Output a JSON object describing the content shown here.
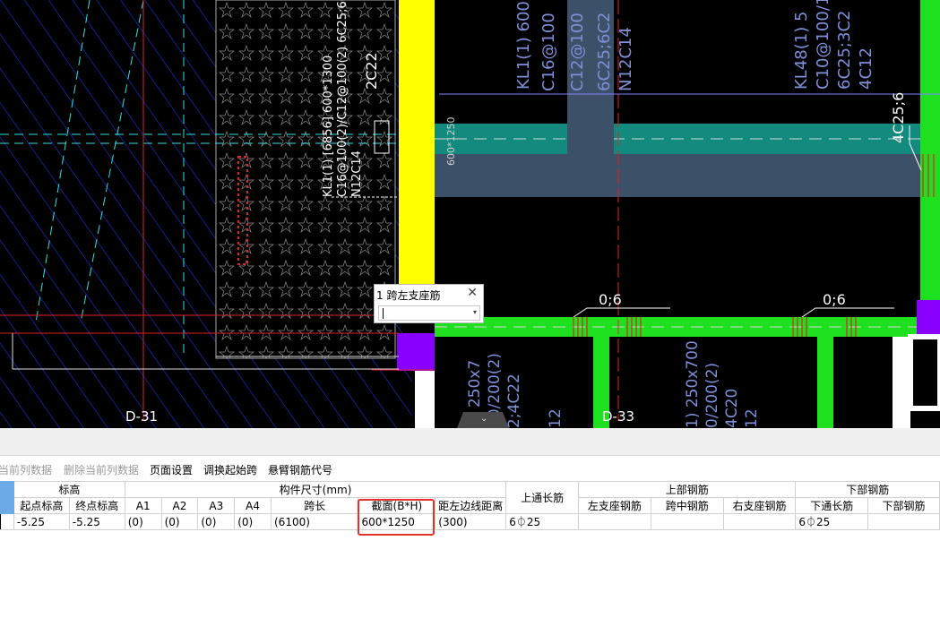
{
  "drawing": {
    "grid_labels": {
      "left": "D-31",
      "right": "D-33"
    },
    "beam_annotations": {
      "kl1_main": [
        "KL1(1) [6856] 600*1300",
        "C16@100(2)/C12@100(2) 6C25;6C",
        "N12C14"
      ],
      "kl1_side": "2C22",
      "kl1_top": [
        "KL1(1) 600",
        "C16@100",
        "C12@100",
        "6C25;6C2",
        "N12C14"
      ],
      "kl48_top": [
        "KL48(1) 5",
        "C10@100/15",
        "6C25;3C2",
        "4C12"
      ],
      "section_label": "600*1250",
      "right_rebar": "4C25;6",
      "rebar_mark_left": "0;6",
      "rebar_mark_right": "0;6",
      "lower_beam_left": [
        "1) 250x7",
        "00/200(2)",
        "2;4C22",
        "12"
      ],
      "lower_beam_right": [
        "1) 250x700",
        "0/200(2)",
        "4C20",
        "12"
      ]
    }
  },
  "popup": {
    "title": "1 跨左支座筋",
    "close": "✕",
    "value": ""
  },
  "toolbar": {
    "items": [
      {
        "label": "当前列数据",
        "disabled": true
      },
      {
        "label": "删除当前列数据",
        "disabled": true
      },
      {
        "label": "页面设置",
        "disabled": false
      },
      {
        "label": "调换起始跨",
        "disabled": false
      },
      {
        "label": "悬臂钢筋代号",
        "disabled": false
      }
    ]
  },
  "table": {
    "group_headers": {
      "elevation": "标高",
      "dimensions": "构件尺寸(mm)",
      "top_through": "上通长筋",
      "top_rebar": "上部钢筋",
      "bottom_rebar": "下部钢筋"
    },
    "columns": {
      "start_elev": "起点标高",
      "end_elev": "终点标高",
      "a1": "A1",
      "a2": "A2",
      "a3": "A3",
      "a4": "A4",
      "span": "跨长",
      "section": "截面(B*H)",
      "dist_left": "距左边线距离",
      "left_support": "左支座钢筋",
      "mid_span": "跨中钢筋",
      "right_support": "右支座钢筋",
      "bottom_through": "下通长筋",
      "bottom_rebar": "下部钢筋"
    },
    "row": {
      "start_elev": "-5.25",
      "end_elev": "-5.25",
      "a1": "(0)",
      "a2": "(0)",
      "a3": "(0)",
      "a4": "(0)",
      "span": "(6100)",
      "section": "600*1250",
      "dist_left": "(300)",
      "top_through": "6⏀25",
      "left_support": "",
      "mid_span": "",
      "right_support": "",
      "bottom_through": "6⏀25",
      "bottom_rebar": ""
    }
  },
  "colors": {
    "canvas_bg": "#000000",
    "hatch": "#1f2fd6",
    "beam_teal": "#128a7e",
    "beam_green": "#1fe01f",
    "column_yellow": "#ffff00",
    "support_purple": "#8a00ff",
    "axis_red": "#e0202a",
    "row_select": "#6baae6",
    "highlight_red": "#e5312a"
  }
}
